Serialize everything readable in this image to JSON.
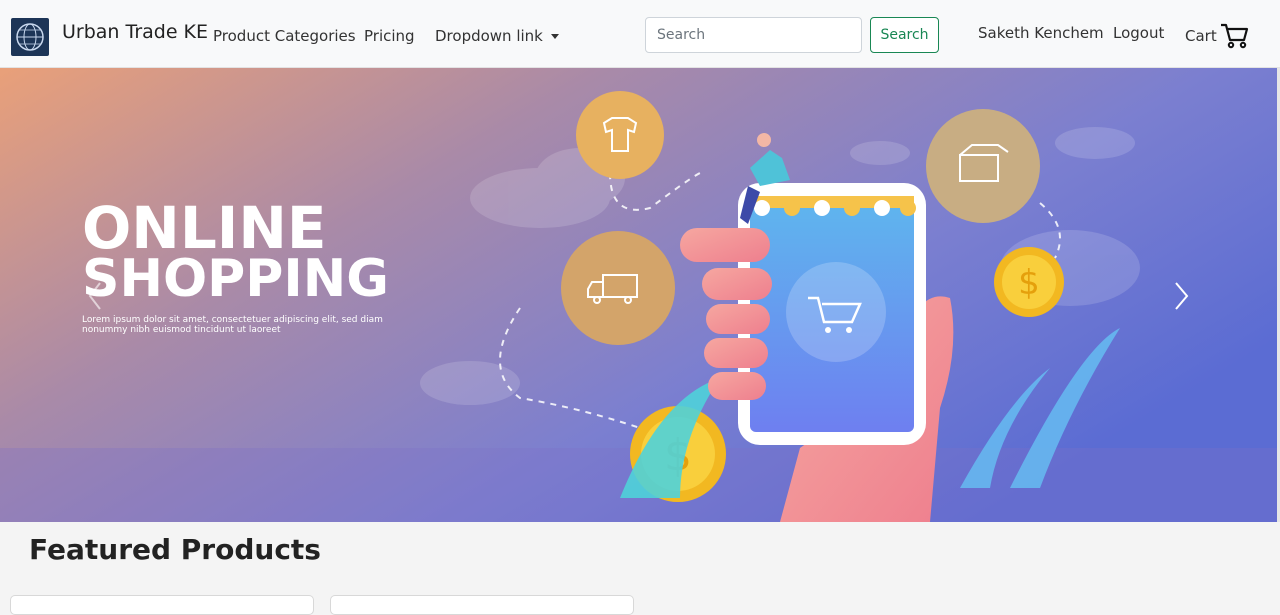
{
  "brand": {
    "name": "Urban Trade KE"
  },
  "nav": {
    "links": [
      "Product Categories",
      "Pricing",
      "Dropdown link"
    ]
  },
  "search": {
    "placeholder": "Search",
    "button_label": "Search"
  },
  "user": {
    "name": "Saketh Kenchem",
    "logout_label": "Logout",
    "cart_label": "Cart"
  },
  "hero": {
    "headline_line1": "ONLINE",
    "headline_line2": "SHOPPING",
    "body_line1": "Lorem ipsum dolor sit amet, consectetuer adipiscing elit, sed diam",
    "body_line2": "nonummy nibh euismod tincidunt ut laoreet",
    "coin_symbol": "$"
  },
  "main": {
    "featured_title": "Featured Products"
  },
  "colors": {
    "primary_green": "#198754",
    "nav_bg": "#f8f9fa"
  }
}
